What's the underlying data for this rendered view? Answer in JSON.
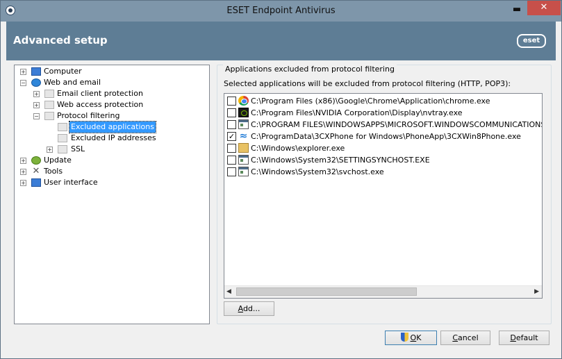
{
  "window": {
    "title": "ESET Endpoint Antivirus",
    "minimize_glyph": "▬",
    "maximize_glyph": "",
    "close_glyph": "✕"
  },
  "header": {
    "title": "Advanced setup",
    "logo": "eset"
  },
  "tree": {
    "computer": "Computer",
    "web_and_email": "Web and email",
    "email_client_protection": "Email client protection",
    "web_access_protection": "Web access protection",
    "protocol_filtering": "Protocol filtering",
    "excluded_applications": "Excluded applications",
    "excluded_ip_addresses": "Excluded IP addresses",
    "ssl": "SSL",
    "update": "Update",
    "tools": "Tools",
    "user_interface": "User interface",
    "plus": "+",
    "minus": "−"
  },
  "panel": {
    "group_title": "Applications excluded from protocol filtering",
    "description": "Selected applications will be excluded from protocol filtering (HTTP, POP3):",
    "apps": [
      {
        "path": "C:\\Program Files (x86)\\Google\\Chrome\\Application\\chrome.exe",
        "checked": false,
        "icon": "chrome-icon"
      },
      {
        "path": "C:\\Program Files\\NVIDIA Corporation\\Display\\nvtray.exe",
        "checked": false,
        "icon": "nvidia-icon"
      },
      {
        "path": "C:\\PROGRAM FILES\\WINDOWSAPPS\\MICROSOFT.WINDOWSCOMMUNICATIONSAPPS_",
        "checked": false,
        "icon": "application-window-icon"
      },
      {
        "path": "C:\\ProgramData\\3CXPhone for Windows\\PhoneApp\\3CXWin8Phone.exe",
        "checked": true,
        "icon": "wifi-icon"
      },
      {
        "path": "C:\\Windows\\explorer.exe",
        "checked": false,
        "icon": "folder-icon"
      },
      {
        "path": "C:\\Windows\\System32\\SETTINGSYNCHOST.EXE",
        "checked": false,
        "icon": "application-window-icon"
      },
      {
        "path": "C:\\Windows\\System32\\svchost.exe",
        "checked": false,
        "icon": "application-window-icon"
      }
    ],
    "check_mark": "✓",
    "scroll_left": "◀",
    "scroll_right": "▶",
    "add_label_underlined": "A",
    "add_label_rest": "dd..."
  },
  "buttons": {
    "ok_underlined": "O",
    "ok_rest": "K",
    "cancel_underlined": "C",
    "cancel_rest": "ancel",
    "default_underlined": "D",
    "default_rest": "efault"
  }
}
